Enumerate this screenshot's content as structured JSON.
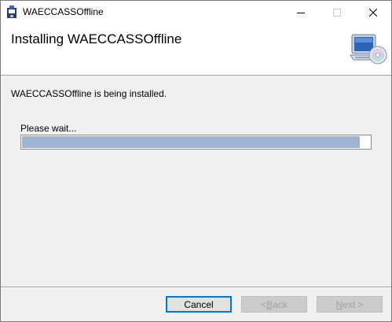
{
  "window": {
    "title": "WAECCASSOffline",
    "app_icon": "installer-icon"
  },
  "titlebar_buttons": {
    "minimize": "minimize-icon",
    "maximize": "maximize-icon",
    "close": "close-icon"
  },
  "banner": {
    "title": "Installing WAECCASSOffline",
    "icon": "computer-cd-icon"
  },
  "body": {
    "status": "WAECCASSOffline is being installed.",
    "wait_label": "Please wait...",
    "progress_fraction": 0.97,
    "progress_color": "#9db5d2"
  },
  "footer": {
    "cancel_label": "Cancel",
    "back_label": "< Back",
    "back_prefix": "< ",
    "back_mnemonic": "B",
    "back_rest": "ack",
    "next_mnemonic": "N",
    "next_rest": "ext >",
    "next_label": "Next >",
    "back_enabled": false,
    "next_enabled": false
  }
}
